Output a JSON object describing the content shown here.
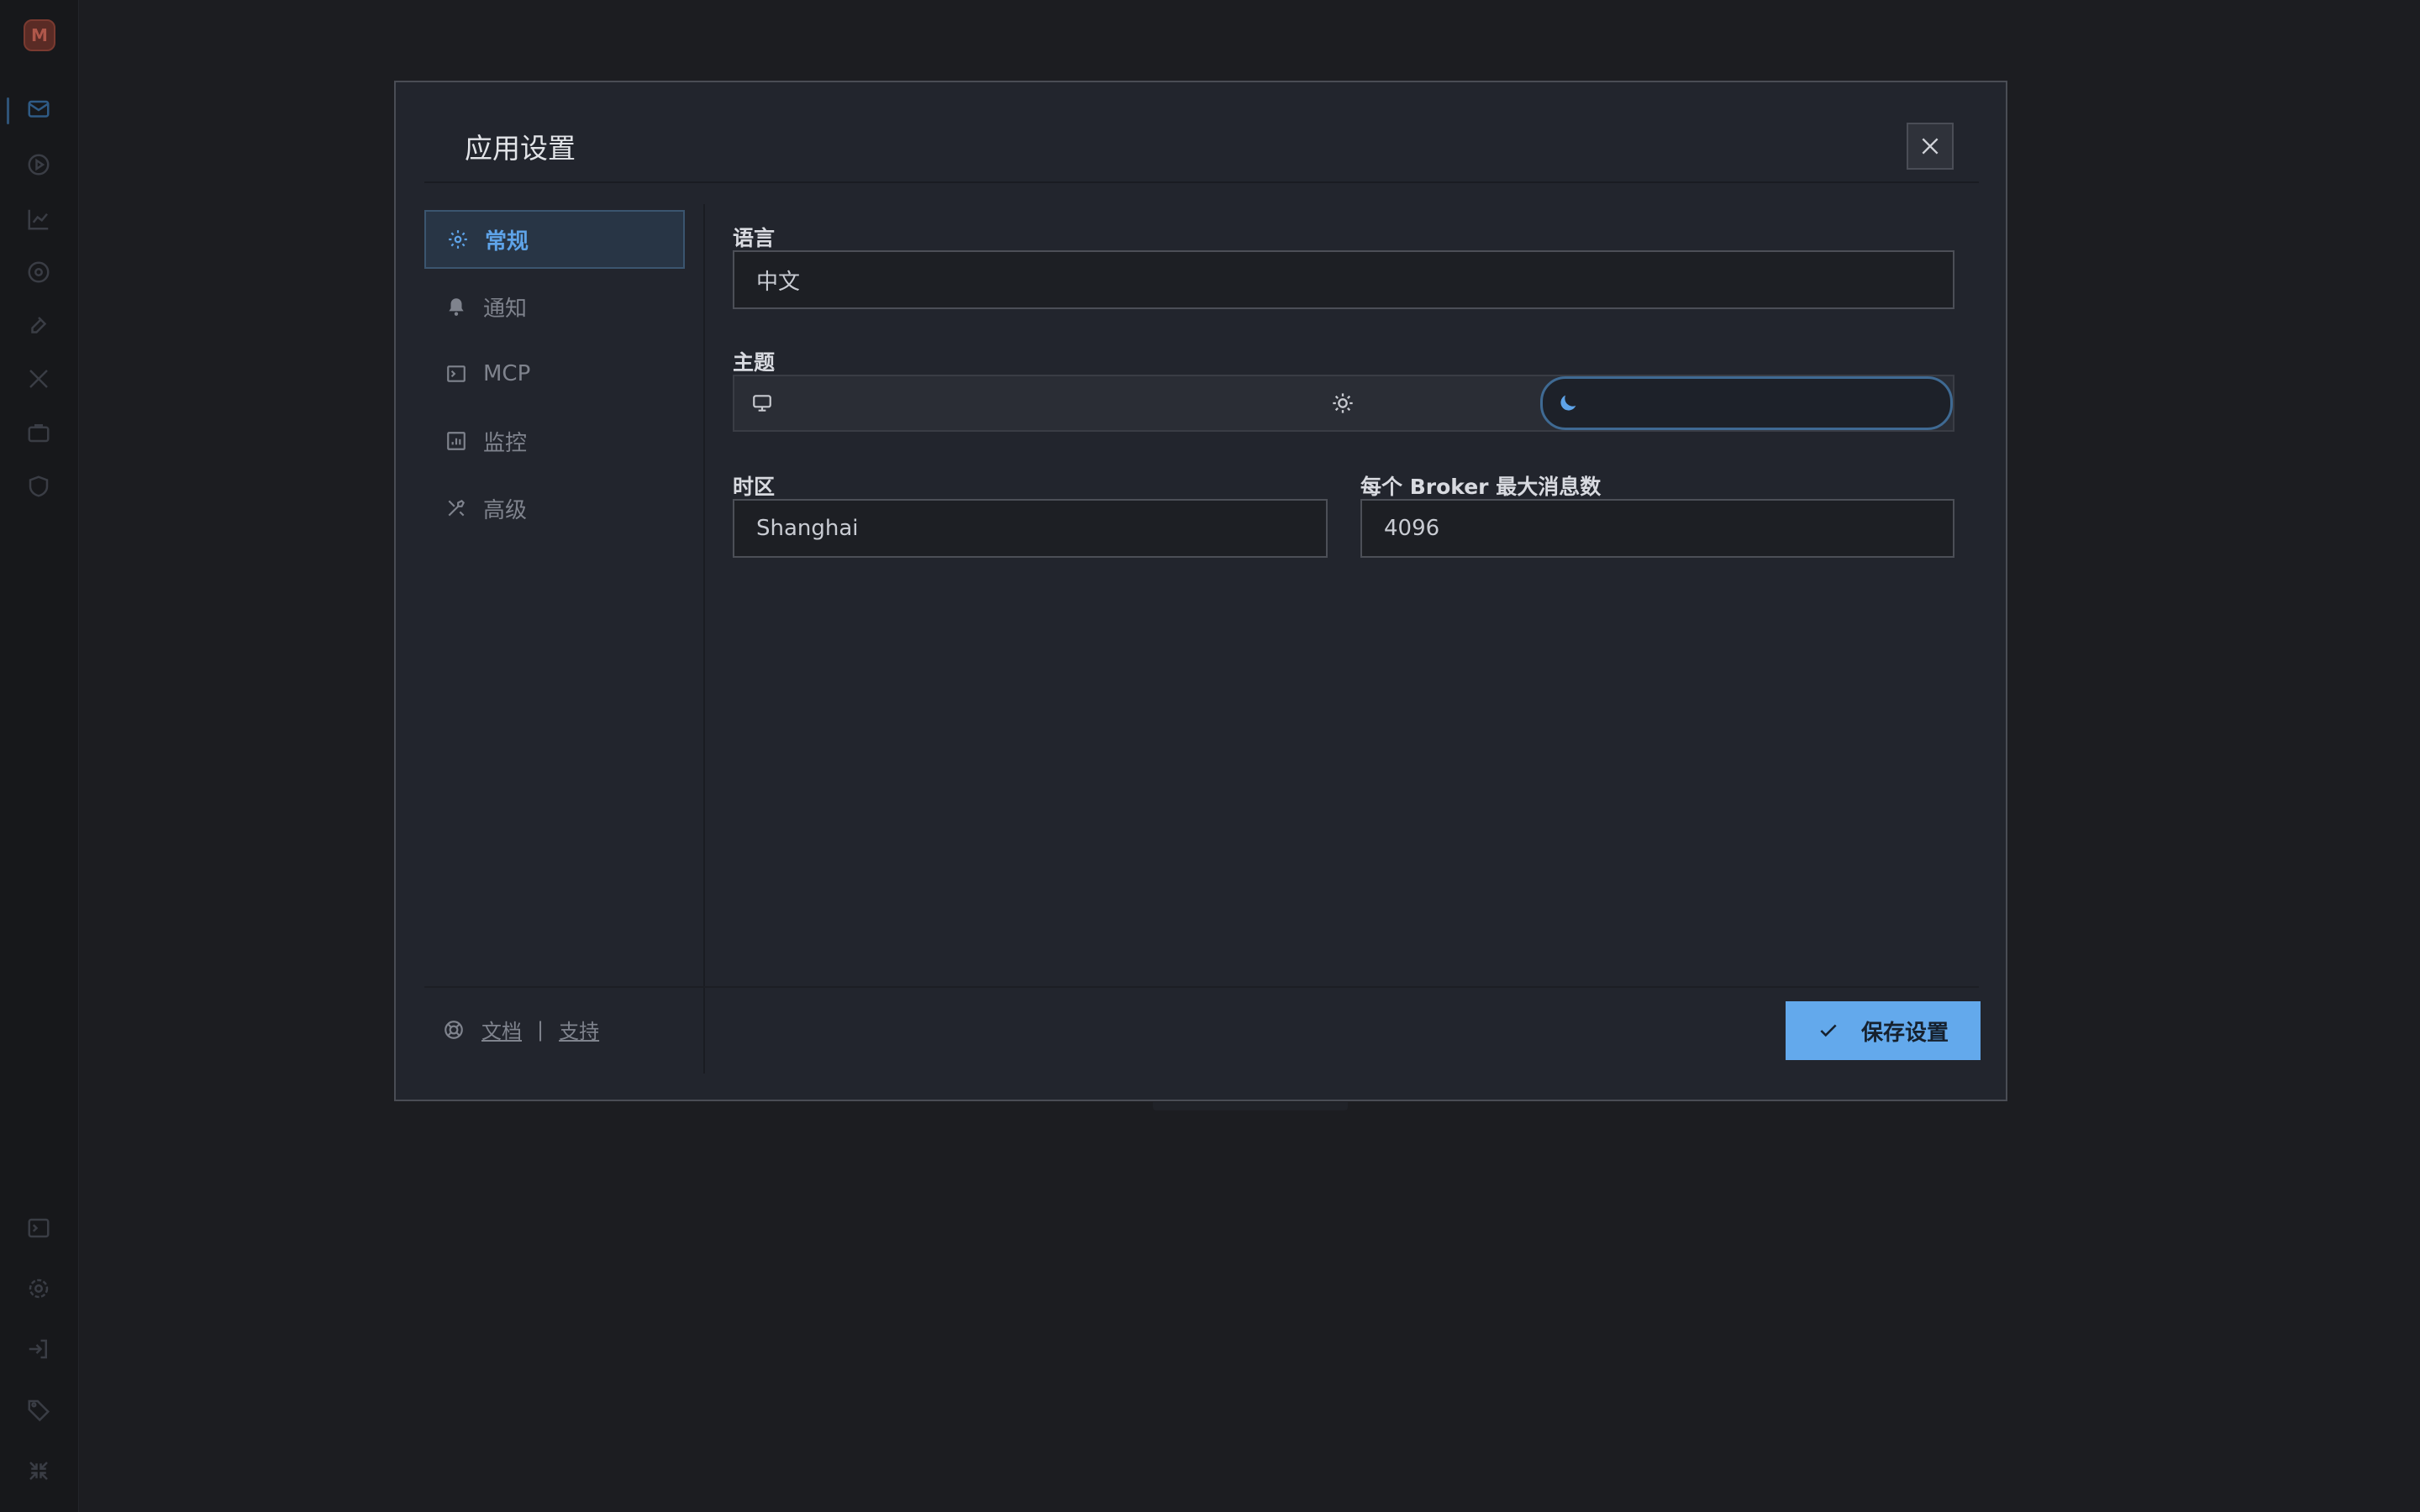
{
  "app": {
    "logo_letter": "M",
    "sidebar_top_icons": [
      "message-icon",
      "play-circle-icon",
      "chart-icon",
      "broker-icon",
      "wrench-icon",
      "tools-icon",
      "briefcase-icon",
      "shield-icon"
    ],
    "sidebar_bottom_icons": [
      "terminal-icon",
      "gear-icon",
      "login-icon",
      "tag-icon",
      "collapse-icon"
    ]
  },
  "dialog": {
    "title": "应用设置",
    "nav": [
      {
        "label": "常规",
        "icon": "gear-icon",
        "active": true
      },
      {
        "label": "通知",
        "icon": "bell-icon",
        "active": false
      },
      {
        "label": "MCP",
        "icon": "terminal-icon",
        "active": false
      },
      {
        "label": "监控",
        "icon": "monitor-chart-icon",
        "active": false
      },
      {
        "label": "高级",
        "icon": "tools-icon",
        "active": false
      }
    ],
    "footer": {
      "docs": "文档",
      "separator": "|",
      "support": "支持"
    },
    "fields": {
      "language": {
        "label": "语言",
        "value": "中文"
      },
      "theme": {
        "label": "主题",
        "options": [
          "system",
          "light",
          "dark"
        ],
        "selected": "dark"
      },
      "timezone": {
        "label": "时区",
        "value": "Shanghai"
      },
      "max_messages": {
        "label": "每个 Broker 最大消息数",
        "value": "4096"
      }
    },
    "save_label": "保存设置"
  },
  "colors": {
    "accent": "#63a9ec",
    "dialog_bg": "#22252d",
    "page_bg": "#1c1d21"
  }
}
